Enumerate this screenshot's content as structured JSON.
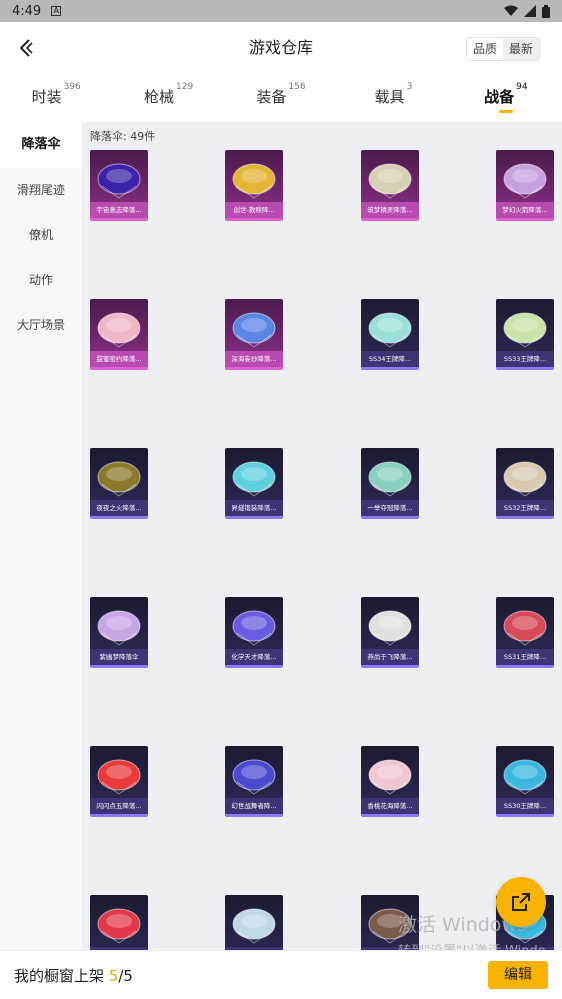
{
  "status_bar": {
    "time": "4:49",
    "notif_icon": "A"
  },
  "header": {
    "title": "游戏仓库",
    "sort_options": [
      "品质",
      "最新"
    ]
  },
  "tabs": [
    {
      "label": "时装",
      "count": "396"
    },
    {
      "label": "枪械",
      "count": "129"
    },
    {
      "label": "装备",
      "count": "156"
    },
    {
      "label": "载具",
      "count": "3"
    },
    {
      "label": "战备",
      "count": "94"
    }
  ],
  "sidebar": {
    "items": [
      "降落伞",
      "滑翔尾迹",
      "僚机",
      "动作",
      "大厅场景"
    ]
  },
  "content": {
    "count_label": "降落伞: 49件",
    "items": [
      {
        "name": "宇宙意志降落...",
        "rarity": "pink",
        "color": "#3b22a8"
      },
      {
        "name": "创世-救赎降...",
        "rarity": "pink",
        "color": "#e3b638"
      },
      {
        "name": "筑梦精灵降落...",
        "rarity": "pink",
        "color": "#d7d0b2"
      },
      {
        "name": "梦幻火箭降落...",
        "rarity": "pink",
        "color": "#c7a2e0"
      },
      {
        "name": "甜蜜密约降落...",
        "rarity": "pink",
        "color": "#f0b7c9"
      },
      {
        "name": "深海妄炒降落...",
        "rarity": "pink",
        "color": "#5a86e6"
      },
      {
        "name": "SS34王牌降...",
        "rarity": "blue",
        "color": "#9be0d8"
      },
      {
        "name": "SS33王牌降...",
        "rarity": "blue",
        "color": "#c9e3a8"
      },
      {
        "name": "夜夜之火降落...",
        "rarity": "blue",
        "color": "#8a7a2a"
      },
      {
        "name": "昇燧锻装降落...",
        "rarity": "blue",
        "color": "#5fd0e0"
      },
      {
        "name": "一举夺冠降落...",
        "rarity": "blue",
        "color": "#8ad0c0"
      },
      {
        "name": "SS32王牌降...",
        "rarity": "blue",
        "color": "#d8c9b0"
      },
      {
        "name": "紫幽梦降落伞",
        "rarity": "blue",
        "color": "#c7a6e6"
      },
      {
        "name": "化学天才降落...",
        "rarity": "blue",
        "color": "#6a5ce0"
      },
      {
        "name": "燕尚于飞降落...",
        "rarity": "blue",
        "color": "#e0e0e0"
      },
      {
        "name": "SS31王牌降...",
        "rarity": "blue",
        "color": "#d64a5a"
      },
      {
        "name": "闪闪点五降落...",
        "rarity": "blue",
        "color": "#e83a3a"
      },
      {
        "name": "幻世战舞者降...",
        "rarity": "blue",
        "color": "#4a4ad0"
      },
      {
        "name": "香桃花海降落...",
        "rarity": "blue",
        "color": "#f2c6d0"
      },
      {
        "name": "SS30王牌降...",
        "rarity": "blue",
        "color": "#3ab8e0"
      },
      {
        "name": "",
        "rarity": "blue",
        "color": "#e03a4a"
      },
      {
        "name": "",
        "rarity": "blue",
        "color": "#c0d8e8"
      },
      {
        "name": "",
        "rarity": "blue",
        "color": "#7a5a4a"
      },
      {
        "name": "",
        "rarity": "blue",
        "color": "#3ab8e0"
      }
    ]
  },
  "watermark": {
    "line1": "激活 Windows",
    "line2": "转到\"设置\"以激活 Windo"
  },
  "footer": {
    "prefix": "我的橱窗上架",
    "current": "5",
    "slash": "/",
    "total": "5",
    "edit_label": "编辑"
  },
  "colors": {
    "accent": "#f8b300",
    "rare_pink": "#e25fd0",
    "rare_blue": "#8a79ff"
  }
}
